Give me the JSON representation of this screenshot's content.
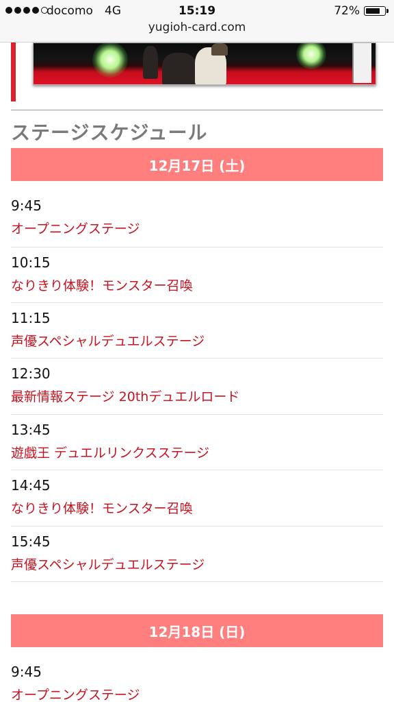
{
  "status_bar": {
    "carrier": "docomo",
    "network": "4G",
    "time": "15:19",
    "battery": "72%",
    "battery_level": 0.72,
    "signal_bars": 4
  },
  "url_bar": {
    "url": "yugioh-card.com"
  },
  "schedule": {
    "title": "ステージスケジュール",
    "days": [
      {
        "header": "12月17日 (土)",
        "items": [
          {
            "time": "9:45",
            "title": "オープニングステージ"
          },
          {
            "time": "10:15",
            "title": "なりきり体験！モンスター召喚"
          },
          {
            "time": "11:15",
            "title": "声優スペシャルデュエルステージ"
          },
          {
            "time": "12:30",
            "title": "最新情報ステージ 20thデュエルロード"
          },
          {
            "time": "13:45",
            "title": "遊戯王 デュエルリンクスステージ"
          },
          {
            "time": "14:45",
            "title": "なりきり体験！モンスター召喚"
          },
          {
            "time": "15:45",
            "title": "声優スペシャルデュエルステージ"
          }
        ]
      },
      {
        "header": "12月18日 (日)",
        "items": [
          {
            "time": "9:45",
            "title": "オープニングステージ"
          }
        ]
      }
    ]
  },
  "colors": {
    "accent_red": "#c8121f",
    "header_pink": "#ff7f7f",
    "left_bar_red": "#d8232a",
    "section_title_gray": "#7a7a7a"
  }
}
